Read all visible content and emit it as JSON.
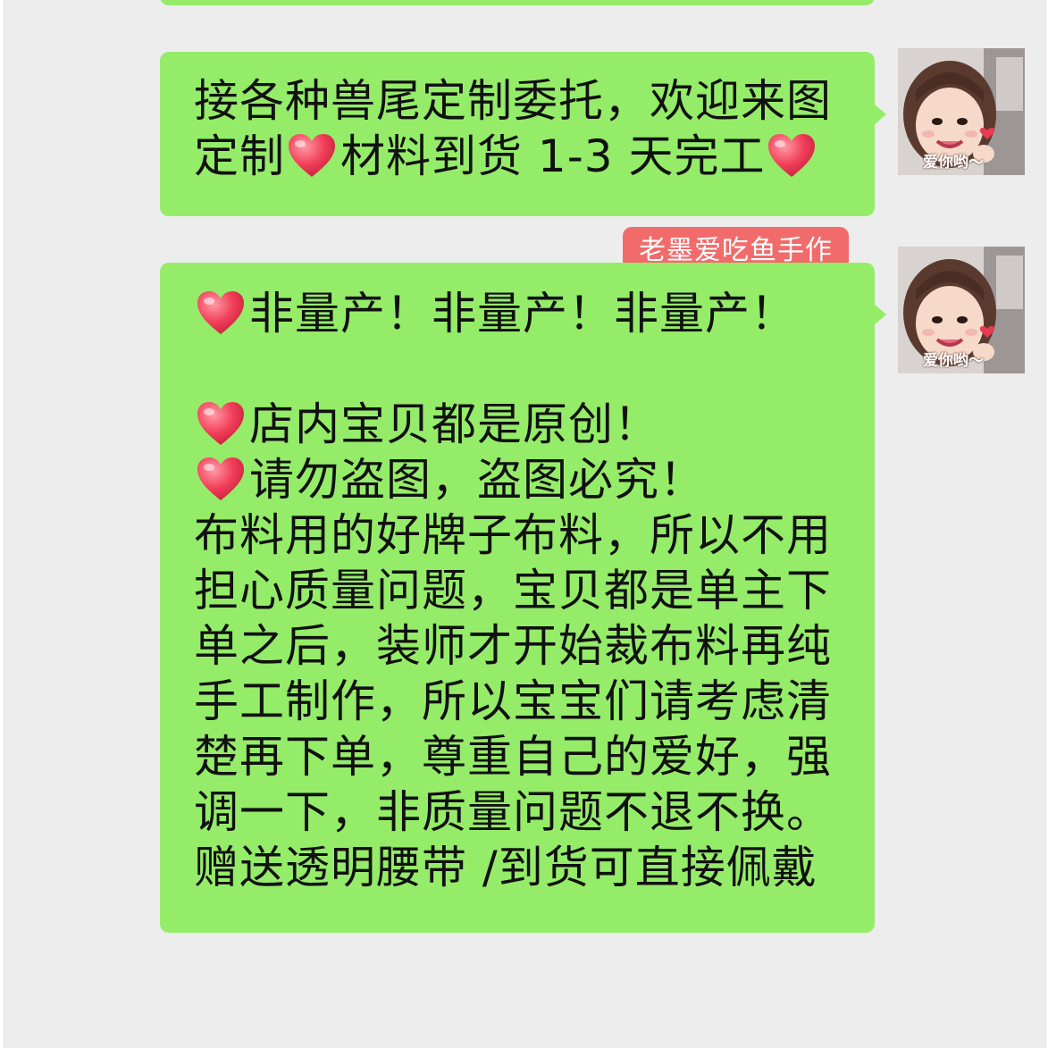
{
  "chat": {
    "background_color": "#ededed",
    "bubble_color": "#95ec69",
    "tag_color": "#f26b6b",
    "messages": [
      {
        "lines": [
          "接各种兽尾定制委托，欢迎来图",
          [
            "定制",
            "heart",
            "材料到货 1-3 天完工",
            "heart"
          ]
        ],
        "avatar": {
          "icon": "avatar-girl-icon",
          "caption": "爱你哟～"
        }
      },
      {
        "sender_tag": "老墨爱吃鱼手作",
        "lines": [
          [
            "heart",
            "非量产！非量产！非量产！"
          ],
          "",
          [
            "heart",
            "店内宝贝都是原创！"
          ],
          [
            "heart",
            "请勿盗图，盗图必究！"
          ],
          "布料用的好牌子布料，所以不用",
          "担心质量问题，宝贝都是单主下",
          "单之后，装师才开始裁布料再纯",
          "手工制作，所以宝宝们请考虑清",
          "楚再下单，尊重自己的爱好，强",
          "调一下，非质量问题不退不换。",
          "赠送透明腰带 /到货可直接佩戴"
        ],
        "avatar": {
          "icon": "avatar-girl-icon",
          "caption": "爱你哟～"
        }
      }
    ]
  },
  "icons": {
    "heart": "heart-emoji-icon"
  },
  "line_texts": {
    "m1_l1": "接各种兽尾定制委托，欢迎来图",
    "m1_l2_a": "定制",
    "m1_l2_b": "材料到货 1-3 天完工",
    "m2_l1": "非量产！非量产！非量产！",
    "m2_l3": "店内宝贝都是原创！",
    "m2_l4": "请勿盗图，盗图必究！",
    "m2_l5": "布料用的好牌子布料，所以不用",
    "m2_l6": "担心质量问题，宝贝都是单主下",
    "m2_l7": "单之后，装师才开始裁布料再纯",
    "m2_l8": "手工制作，所以宝宝们请考虑清",
    "m2_l9": "楚再下单，尊重自己的爱好，强",
    "m2_l10": "调一下，非质量问题不退不换。",
    "m2_l11": "赠送透明腰带 /到货可直接佩戴",
    "tag": "老墨爱吃鱼手作",
    "caption": "爱你哟～"
  }
}
